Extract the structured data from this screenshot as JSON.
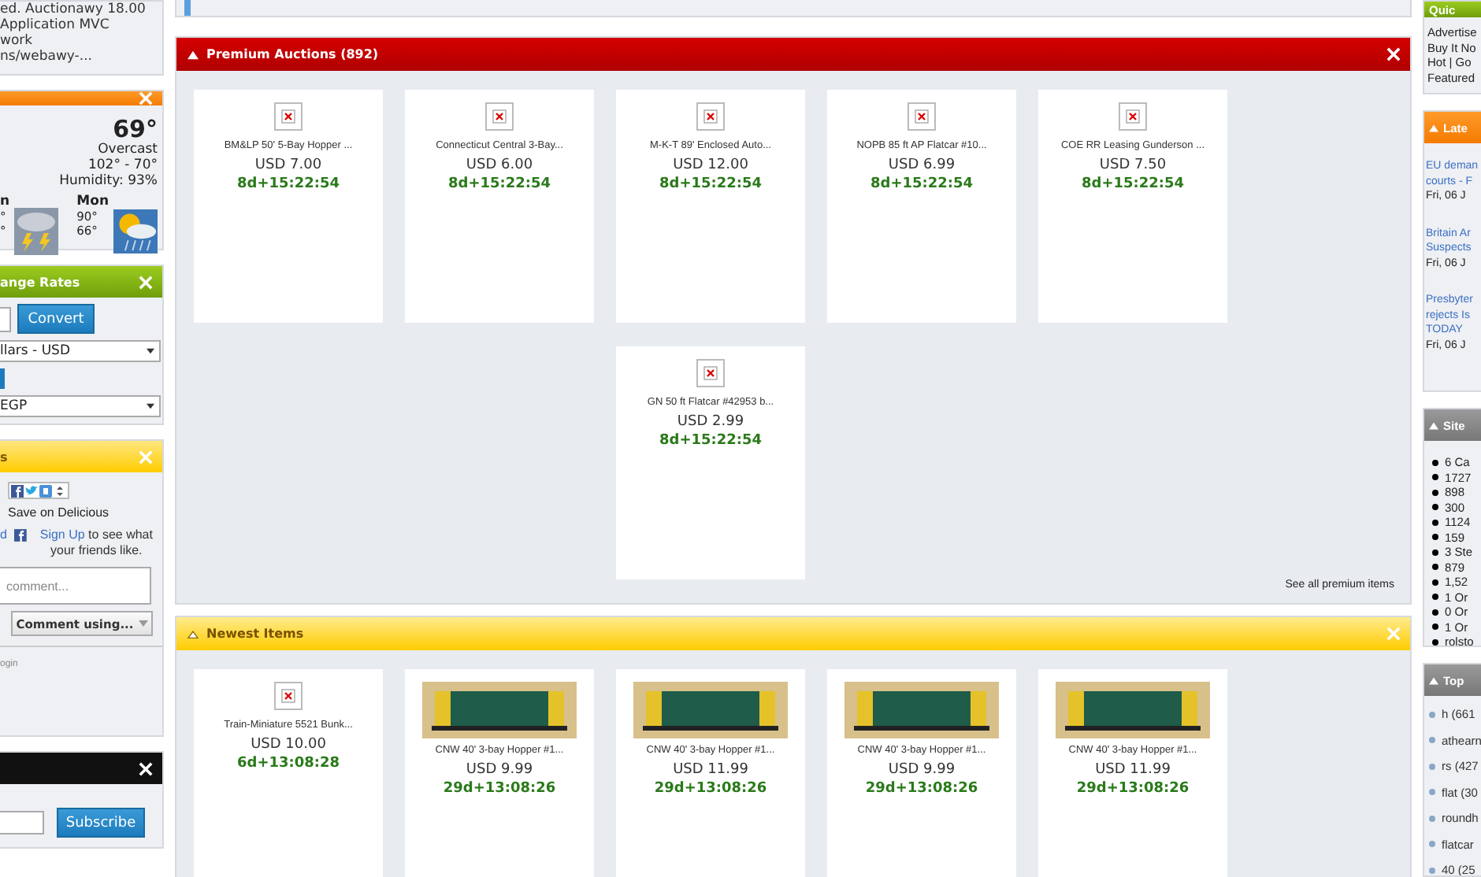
{
  "left": {
    "intro_lines": [
      "ed. Auctionawy 18.00",
      "Application MVC",
      "work",
      "ns/webawy-..."
    ],
    "weather": {
      "temperature": "69°",
      "condition": "Overcast",
      "range": "102° - 70°",
      "humidity": "Humidity: 93%",
      "forecast": [
        {
          "day": "n",
          "high": "°",
          "low": "°",
          "kind": "storm"
        },
        {
          "day": "Mon",
          "high": "90°",
          "low": "66°",
          "kind": "sun-rain"
        }
      ]
    },
    "exchange": {
      "title": "ange Rates",
      "convert_button": "Convert",
      "from_currency": "llars - USD",
      "to_currency": "EGP"
    },
    "share": {
      "title": "s",
      "delicious": "Save on Delicious",
      "signup_prefix": "d",
      "signup_link": "Sign Up",
      "signup_text": "to see what your friends like.",
      "comment_placeholder": "comment...",
      "comment_button": "Comment using...",
      "login": "ogin"
    },
    "newsletter": {
      "subscribe_button": "Subscribe"
    }
  },
  "premium": {
    "title": "Premium Auctions (892)",
    "items": [
      {
        "title": "BM&LP 50' 5-Bay Hopper ...",
        "price": "USD 7.00",
        "time_left": "8d+15:22:54",
        "kind": "broken"
      },
      {
        "title": "Connecticut Central 3-Bay...",
        "price": "USD 6.00",
        "time_left": "8d+15:22:54",
        "kind": "broken"
      },
      {
        "title": "M-K-T 89' Enclosed Auto...",
        "price": "USD 12.00",
        "time_left": "8d+15:22:54",
        "kind": "broken"
      },
      {
        "title": "NOPB 85 ft AP Flatcar #10...",
        "price": "USD 6.99",
        "time_left": "8d+15:22:54",
        "kind": "broken"
      },
      {
        "title": "COE RR Leasing Gunderson ...",
        "price": "USD 7.50",
        "time_left": "8d+15:22:54",
        "kind": "broken"
      },
      {
        "title": "GN 50 ft Flatcar #42953 b...",
        "price": "USD 2.99",
        "time_left": "8d+15:22:54",
        "kind": "broken"
      }
    ],
    "see_all": "See all premium items"
  },
  "newest": {
    "title": "Newest Items",
    "items": [
      {
        "title": "Train-Miniature 5521 Bunk...",
        "price": "USD 10.00",
        "time_left": "6d+13:08:28",
        "kind": "broken"
      },
      {
        "title": "CNW 40' 3-bay Hopper #1...",
        "price": "USD 9.99",
        "time_left": "29d+13:08:26",
        "kind": "photo"
      },
      {
        "title": "CNW 40' 3-bay Hopper #1...",
        "price": "USD 11.99",
        "time_left": "29d+13:08:26",
        "kind": "photo"
      },
      {
        "title": "CNW 40' 3-bay Hopper #1...",
        "price": "USD 9.99",
        "time_left": "29d+13:08:26",
        "kind": "photo"
      },
      {
        "title": "CNW 40' 3-bay Hopper #1...",
        "price": "USD 11.99",
        "time_left": "29d+13:08:26",
        "kind": "photo"
      }
    ]
  },
  "right": {
    "quick": {
      "title": "Quic",
      "lines": [
        "Advertise",
        "Buy It No",
        "Hot |  Go",
        "Featured"
      ]
    },
    "latest": {
      "title": "Late",
      "news": [
        {
          "lines": [
            "EU deman",
            "courts - F"
          ],
          "date": "Fri, 06 J"
        },
        {
          "lines": [
            "Britain Ar",
            "Suspects"
          ],
          "date": "Fri, 06 J"
        },
        {
          "lines": [
            "Presbyter",
            "rejects Is",
            "TODAY"
          ],
          "date": "Fri, 06 J"
        }
      ]
    },
    "site": {
      "title": "Site",
      "stats": [
        "6 Ca",
        "1727",
        "898",
        "300",
        "1124",
        "159",
        "3 Ste",
        "879",
        "1,52",
        "1 Or",
        "0 Or",
        "1 Or",
        "rolsto"
      ]
    },
    "top": {
      "title": "Top",
      "tags": [
        "h (661",
        "athearn",
        "rs (427",
        "flat (30",
        "roundh",
        "flatcar",
        "40 (25"
      ]
    }
  }
}
